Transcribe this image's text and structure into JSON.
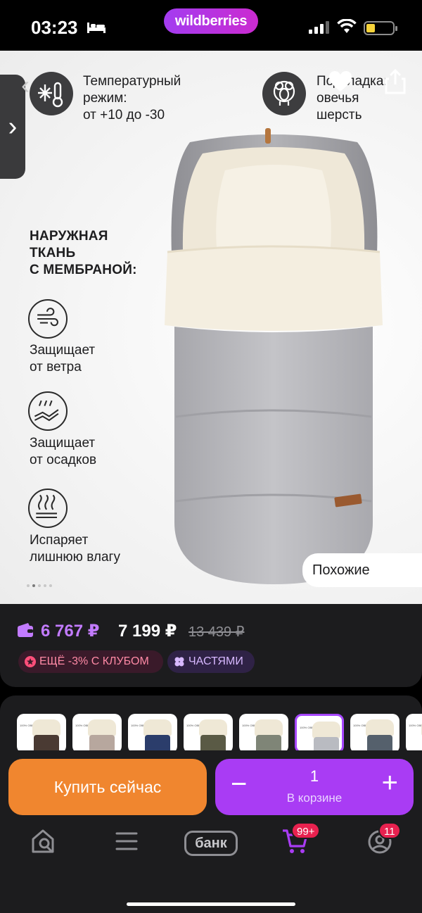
{
  "status_bar": {
    "time": "03:23",
    "logo": "wildberries",
    "icons": [
      "bed-icon",
      "signal-icon",
      "wifi-icon",
      "battery-icon"
    ]
  },
  "product_image": {
    "features_top": [
      {
        "icon": "snowflake-thermometer-icon",
        "text_lines": [
          "Температурный",
          "режим:",
          "от +10 до -30"
        ]
      },
      {
        "icon": "sheep-icon",
        "text_lines": [
          "Подкладка:",
          "овечья",
          "шерсть"
        ]
      }
    ],
    "fabric_title_lines": [
      "НАРУЖНАЯ",
      "ТКАНЬ",
      "С МЕМБРАНОЙ:"
    ],
    "fabric_features": [
      {
        "icon": "wind-icon",
        "text_lines": [
          "Защищает",
          "от ветра"
        ]
      },
      {
        "icon": "rain-icon",
        "text_lines": [
          "Защищает",
          "от осадков"
        ]
      },
      {
        "icon": "steam-icon",
        "text_lines": [
          "Испаряет",
          "лишнюю влагу"
        ]
      }
    ],
    "similar_label": "Похожие",
    "carousel_dots": 5,
    "carousel_active": 2
  },
  "price": {
    "wallet_price": "6 767 ₽",
    "price": "7 199 ₽",
    "old_price": "13 439 ₽",
    "club_chip": "ЕЩЁ -3% С КЛУБОМ",
    "parts_chip": "ЧАСТЯМИ"
  },
  "color_variants": [
    {
      "color": "#4a3a33",
      "selected": false
    },
    {
      "color": "#b7a79e",
      "selected": false
    },
    {
      "color": "#2b3d6b",
      "selected": false
    },
    {
      "color": "#5a5a45",
      "selected": false
    },
    {
      "color": "#7f8577",
      "selected": false
    },
    {
      "color": "#b9bbc1",
      "selected": true
    },
    {
      "color": "#55606c",
      "selected": false
    },
    {
      "color": "#9aa0a6",
      "selected": false
    }
  ],
  "thumb_caption": "100% ОВЕЧЬЯ ШЕРСТЬ",
  "actions": {
    "buy_now": "Купить сейчас",
    "cart_qty": "1",
    "cart_label": "В корзине",
    "minus": "−",
    "plus": "+"
  },
  "tabbar": {
    "bank_label": "банк",
    "cart_badge": "99+",
    "profile_badge": "11"
  },
  "colors": {
    "accent_purple": "#a93cf4",
    "buy_orange": "#f0862f",
    "price_purple": "#c27bff",
    "badge_red": "#e8214f"
  }
}
